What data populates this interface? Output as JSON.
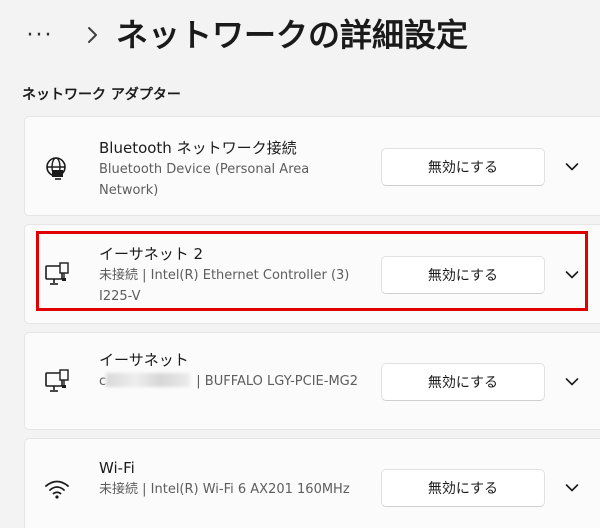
{
  "header": {
    "more": "···",
    "title": "ネットワークの詳細設定"
  },
  "section": {
    "title": "ネットワーク アダプター"
  },
  "adapters": [
    {
      "name": "Bluetooth ネットワーク接続",
      "description": "Bluetooth Device (Personal Area Network)",
      "button": "無効にする",
      "icon": "globe-computer-icon"
    },
    {
      "name": "イーサネット 2",
      "description": "未接続 | Intel(R) Ethernet Controller (3) I225-V",
      "button": "無効にする",
      "icon": "ethernet-computer-icon",
      "highlighted": true
    },
    {
      "name": "イーサネット",
      "status_prefix": "c",
      "description_rest": " | BUFFALO LGY-PCIE-MG2",
      "button": "無効にする",
      "icon": "ethernet-computer-icon"
    },
    {
      "name": "Wi-Fi",
      "description": "未接続 | Intel(R) Wi-Fi 6 AX201 160MHz",
      "button": "無効にする",
      "icon": "wifi-icon"
    }
  ],
  "colors": {
    "background": "#f3f3f3",
    "card": "#fbfbfb",
    "highlight": "#e00000"
  }
}
